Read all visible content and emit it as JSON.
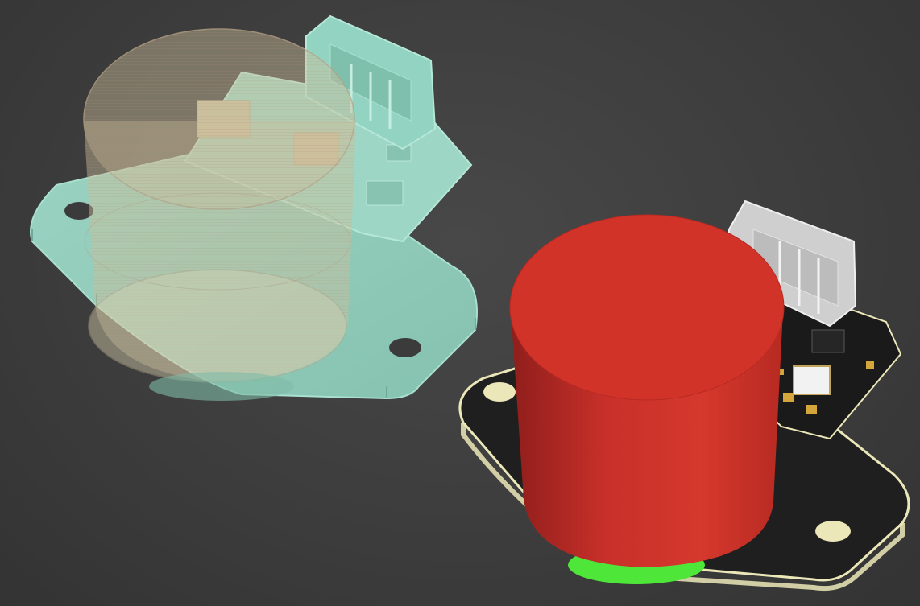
{
  "viewport": {
    "background": "#3c3c3c"
  },
  "models": {
    "left": {
      "style": "transparent wireframe overlay",
      "board_color": "#8fc9b7",
      "board_edge_color": "#a9e0cf",
      "cylinder_color": "#d6c8a2",
      "connector_color": "#93d3c1"
    },
    "right": {
      "style": "shaded solid",
      "cylinder_color": "#c8302a",
      "cylinder_shadow": "#8f1e1b",
      "cylinder_cap_color": "#d23329",
      "board_color": "#1f1f1f",
      "board_edge_color": "#ece7b8",
      "connector_color": "#cfcfcf",
      "bottom_ring_color": "#4fe63a",
      "pad_color": "#d4a53a"
    }
  },
  "icons": {
    "mounting_hole": "mounting-hole-icon",
    "connector": "jst-connector-icon"
  }
}
